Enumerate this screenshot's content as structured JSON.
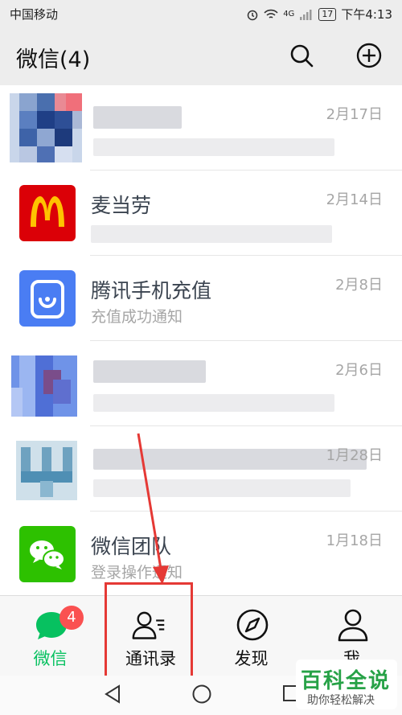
{
  "status_bar": {
    "carrier": "中国移动",
    "signal": "4G",
    "battery": "17",
    "time": "下午4:13"
  },
  "header": {
    "title": "微信(4)"
  },
  "chats": [
    {
      "name": "",
      "preview": "",
      "date": "2月17日",
      "blurred": true
    },
    {
      "name": "麦当劳",
      "preview": "",
      "date": "2月14日",
      "blurred": false
    },
    {
      "name": "腾讯手机充值",
      "preview": "充值成功通知",
      "date": "2月8日",
      "blurred": false
    },
    {
      "name": "",
      "preview": "",
      "date": "2月6日",
      "blurred": true
    },
    {
      "name": "",
      "preview": "",
      "date": "1月28日",
      "blurred": true
    },
    {
      "name": "微信团队",
      "preview": "登录操作通知",
      "date": "1月18日",
      "blurred": false
    }
  ],
  "tabs": [
    {
      "label": "微信",
      "badge": "4",
      "active": true
    },
    {
      "label": "通讯录",
      "active": false
    },
    {
      "label": "发现",
      "active": false
    },
    {
      "label": "我",
      "active": false
    }
  ],
  "colors": {
    "wechat_green": "#07c160",
    "highlight_red": "#e53935",
    "badge_red": "#fa5151"
  },
  "watermark": {
    "title": "百科全说",
    "subtitle": "助你轻松解决"
  }
}
